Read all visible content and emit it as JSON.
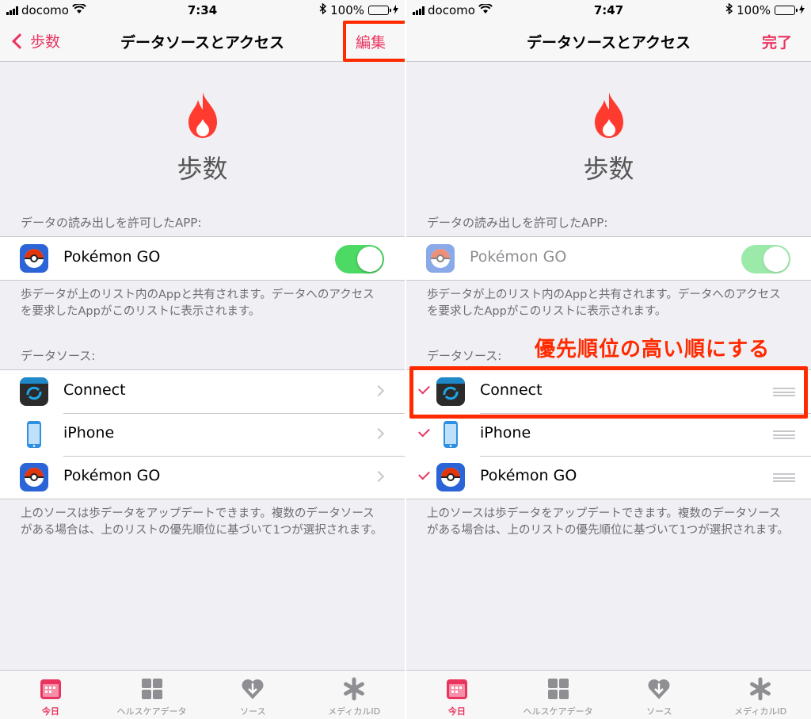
{
  "left": {
    "status": {
      "carrier": "docomo",
      "time": "7:34",
      "battery": "100%"
    },
    "nav": {
      "back_label": "歩数",
      "title": "データソースとアクセス",
      "action_label": "編集"
    },
    "category": "歩数",
    "read_section_header": "データの読み出しを許可したAPP:",
    "read_app": {
      "label": "Pokémon GO",
      "enabled": true
    },
    "read_footer": "歩データが上のリスト内のAppと共有されます。データへのアクセスを要求したAppがこのリストに表示されます。",
    "sources_header": "データソース:",
    "sources": [
      {
        "label": "Connect",
        "icon": "garmin-connect-icon"
      },
      {
        "label": "iPhone",
        "icon": "iphone-icon"
      },
      {
        "label": "Pokémon GO",
        "icon": "pokemon-go-icon"
      }
    ],
    "sources_footer": "上のソースは歩データをアップデートできます。複数のデータソースがある場合は、上のリストの優先順位に基づいて1つが選択されます。"
  },
  "right": {
    "status": {
      "carrier": "docomo",
      "time": "7:47",
      "battery": "100%"
    },
    "nav": {
      "title": "データソースとアクセス",
      "action_label": "完了"
    },
    "category": "歩数",
    "read_section_header": "データの読み出しを許可したAPP:",
    "read_app": {
      "label": "Pokémon GO",
      "enabled": true
    },
    "read_footer": "歩データが上のリスト内のAppと共有されます。データへのアクセスを要求したAppがこのリストに表示されます。",
    "sources_header": "データソース:",
    "callout": "優先順位の高い順にする",
    "sources": [
      {
        "label": "Connect",
        "checked": true
      },
      {
        "label": "iPhone",
        "checked": true
      },
      {
        "label": "Pokémon GO",
        "checked": true
      }
    ],
    "sources_footer": "上のソースは歩データをアップデートできます。複数のデータソースがある場合は、上のリストの優先順位に基づいて1つが選択されます。"
  },
  "tabs": [
    {
      "label": "今日",
      "icon": "today-calendar-icon",
      "active": true
    },
    {
      "label": "ヘルスケアデータ",
      "icon": "health-data-grid-icon",
      "active": false
    },
    {
      "label": "ソース",
      "icon": "sources-heart-icon",
      "active": false
    },
    {
      "label": "メディカルID",
      "icon": "medical-id-asterisk-icon",
      "active": false
    }
  ],
  "colors": {
    "accent": "#e93460",
    "highlight": "#ff2a00",
    "toggle_on": "#4cd964",
    "flame": "#ff3b30"
  }
}
